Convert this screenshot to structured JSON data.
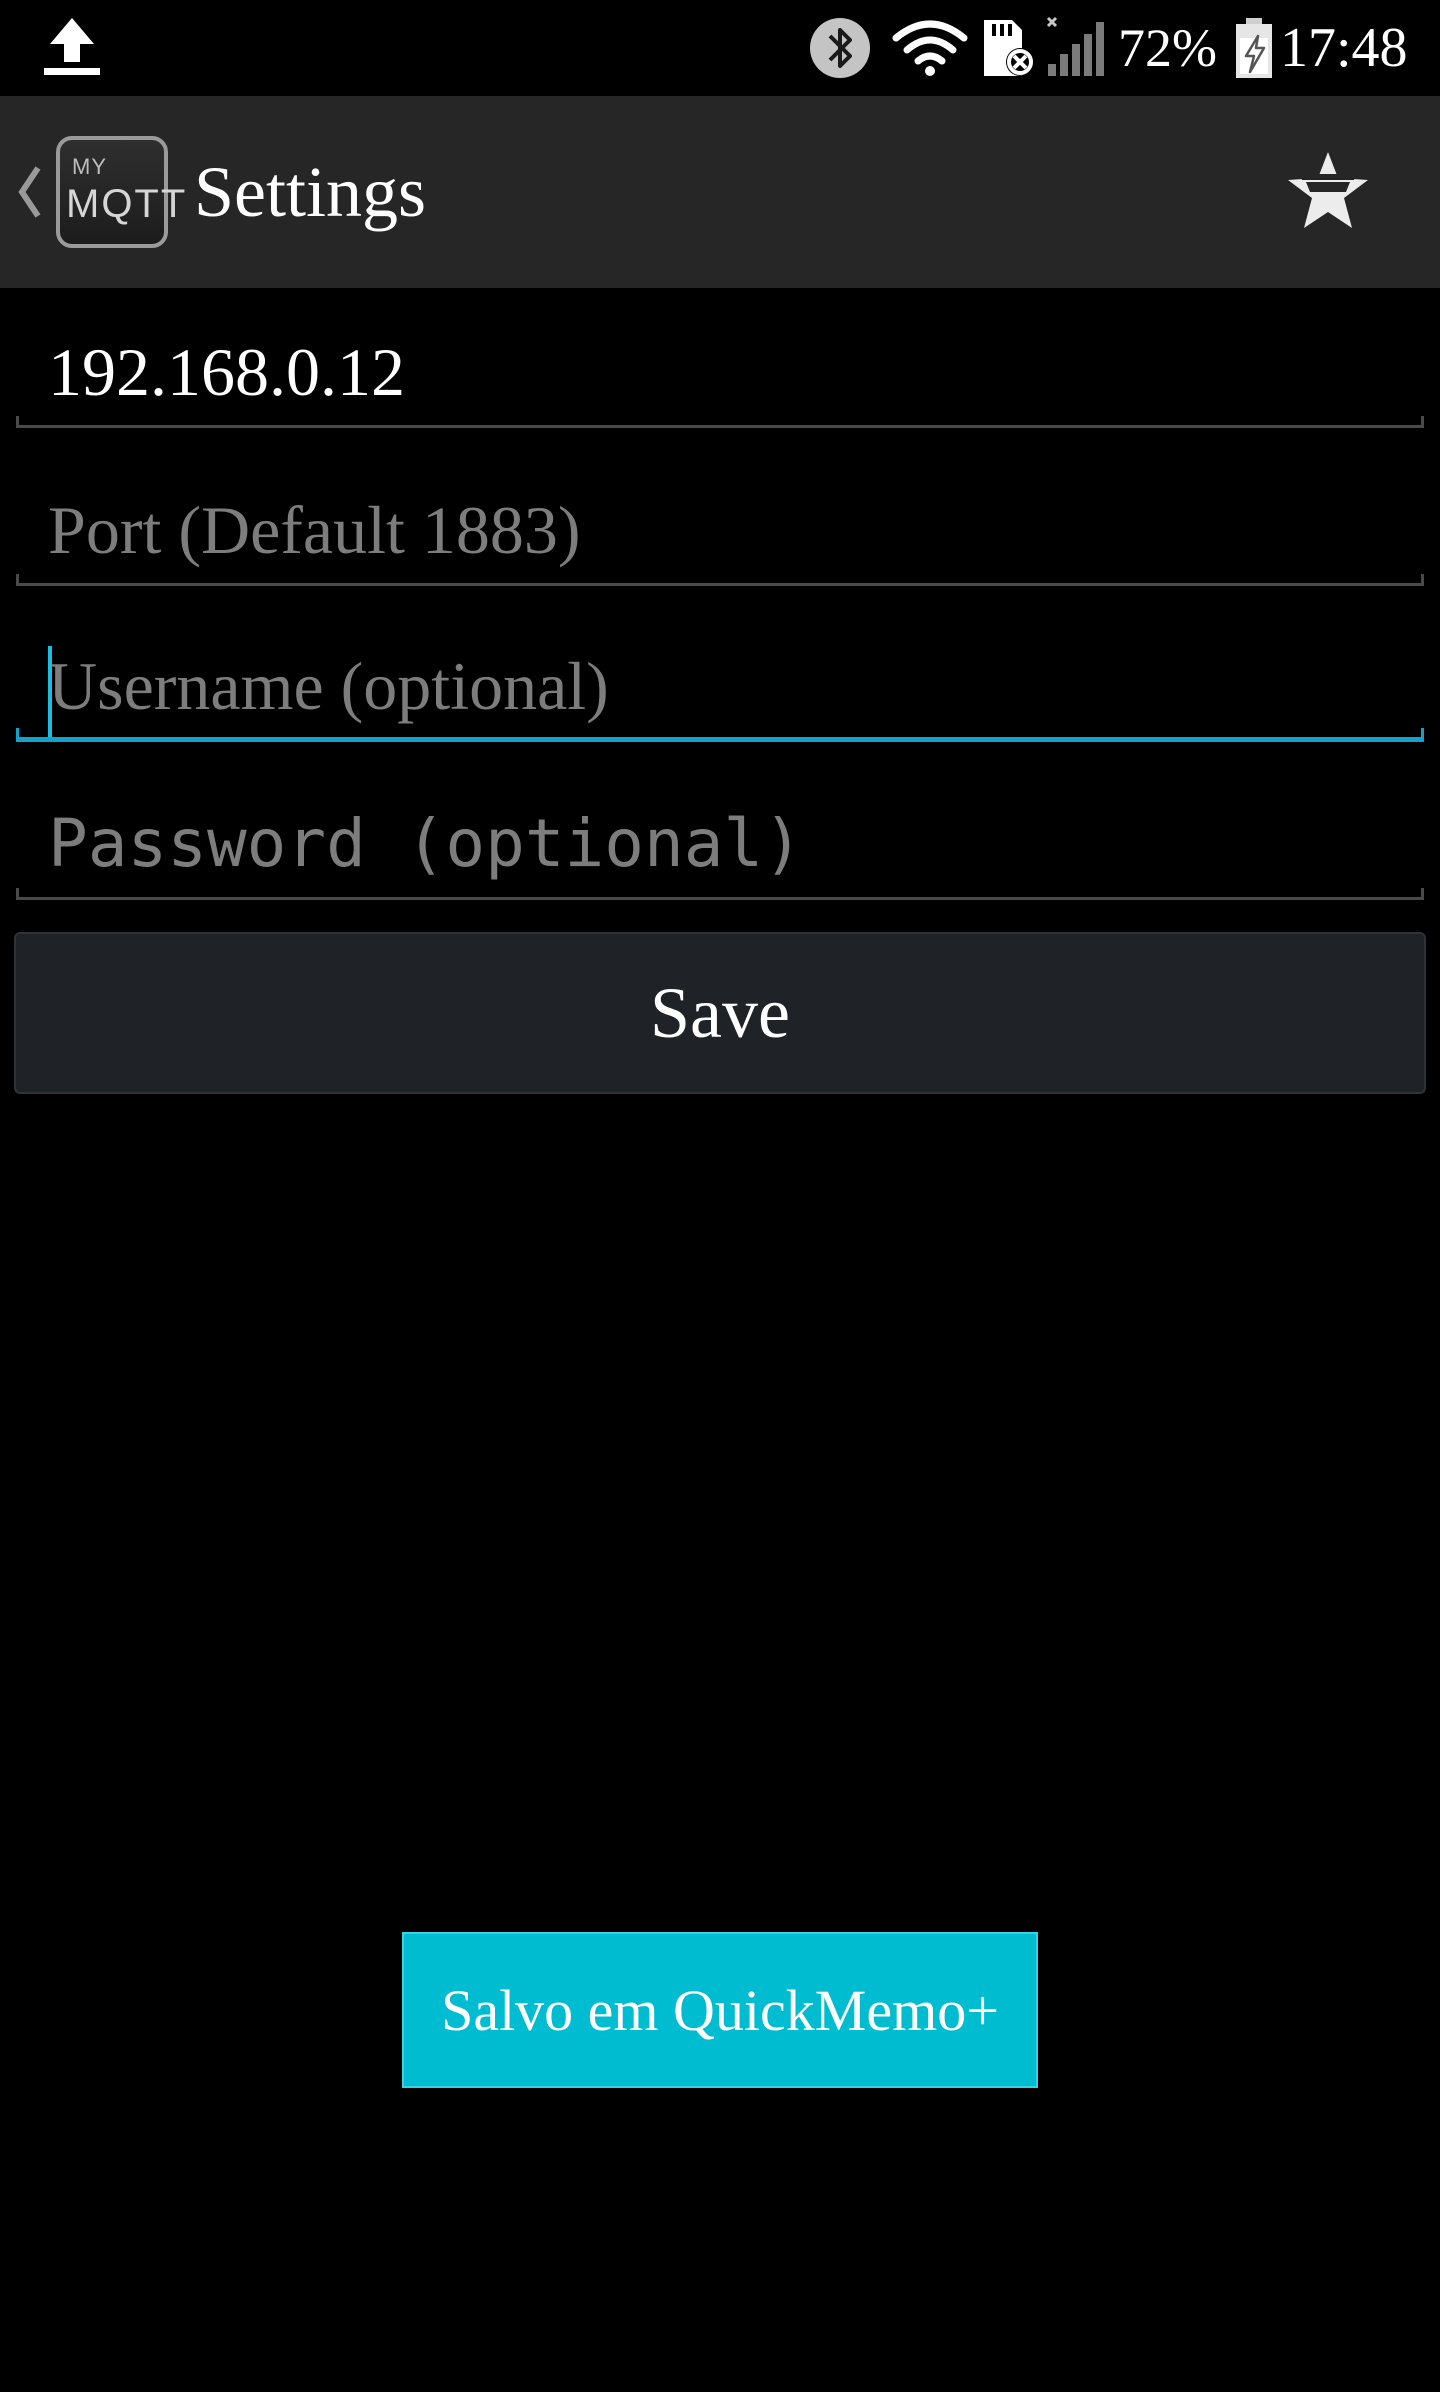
{
  "status_bar": {
    "battery_percent": "72%",
    "time": "17:48",
    "icons": [
      "upload-icon",
      "bluetooth-icon",
      "wifi-icon",
      "sd-card-error-icon",
      "signal-icon",
      "battery-charging-icon"
    ]
  },
  "action_bar": {
    "logo_line1": "MY",
    "logo_line2": "MQTT",
    "title": "Settings",
    "action_icon": "star-badge-icon"
  },
  "form": {
    "host": {
      "value": "192.168.0.12"
    },
    "port": {
      "placeholder": "Port (Default 1883)"
    },
    "username": {
      "placeholder": "Username (optional)",
      "focused": true
    },
    "password": {
      "placeholder": "Password (optional)"
    },
    "save_label": "Save"
  },
  "toast": {
    "text": "Salvo em QuickMemo+"
  },
  "colors": {
    "accent": "#12a3cc",
    "toast_bg": "#00bcd1",
    "action_bar_bg": "#262626",
    "button_bg": "#1f2327"
  }
}
